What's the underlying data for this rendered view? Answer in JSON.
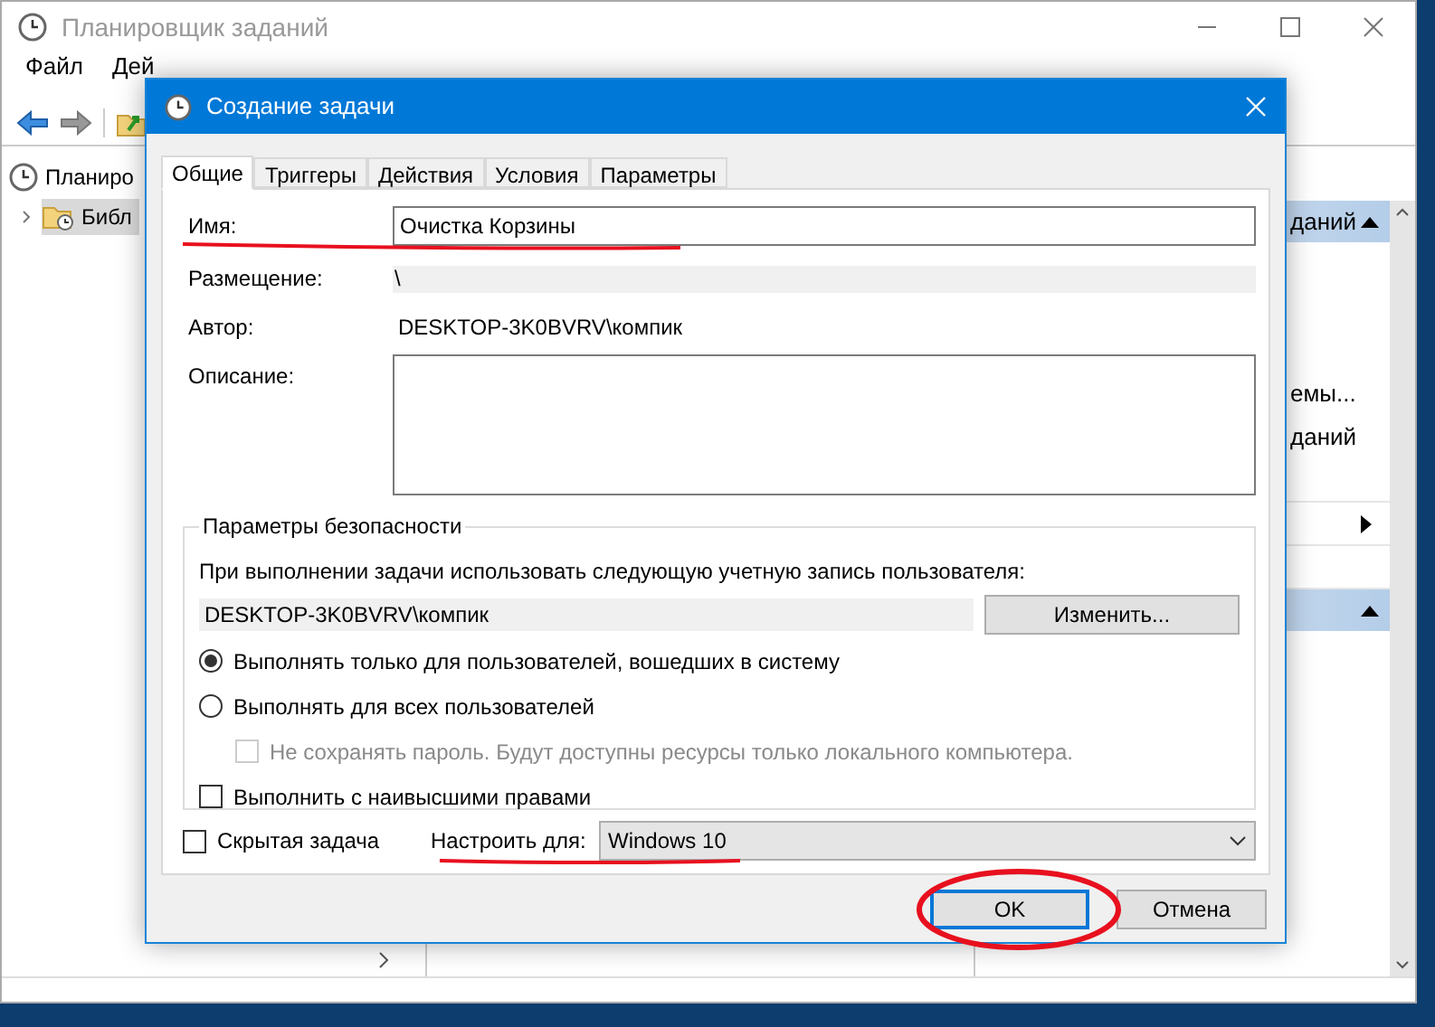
{
  "main_window": {
    "title": "Планировщик заданий",
    "menu": [
      "Файл",
      "Дей"
    ],
    "tree": [
      {
        "label": "Планиро",
        "selected": false,
        "children": [
          {
            "label": "Библ",
            "selected": true,
            "expanded": false
          }
        ]
      }
    ],
    "actions_pane": {
      "sections": [
        {
          "header": "даний",
          "expanded": true,
          "items": [
            {
              "label": "емы..."
            },
            {
              "label": "даний"
            },
            {
              "submenu": false
            },
            {
              "submenu": true
            },
            {
              "submenu": false
            }
          ]
        },
        {
          "expanded": true
        }
      ]
    }
  },
  "dialog": {
    "title": "Создание задачи",
    "tabs": [
      {
        "label": "Общие",
        "selected": true
      },
      {
        "label": "Триггеры",
        "selected": false
      },
      {
        "label": "Действия",
        "selected": false
      },
      {
        "label": "Условия",
        "selected": false
      },
      {
        "label": "Параметры",
        "selected": false
      }
    ],
    "name": {
      "label": "Имя:",
      "value": "Очистка Корзины"
    },
    "location": {
      "label": "Размещение:",
      "value": "\\"
    },
    "author": {
      "label": "Автор:",
      "value": "DESKTOP-3K0BVRV\\компик"
    },
    "description": {
      "label": "Описание:"
    },
    "security": {
      "title": "Параметры безопасности",
      "account_prompt": "При выполнении задачи использовать следующую учетную запись пользователя:",
      "account": "DESKTOP-3K0BVRV\\компик",
      "change_button": "Изменить...",
      "options": [
        {
          "kind": "radio",
          "label": "Выполнять только для пользователей, вошедших в систему",
          "selected": true
        },
        {
          "kind": "radio",
          "label": "Выполнять для всех пользователей",
          "selected": false,
          "children": [
            {
              "kind": "checkbox",
              "label": "Не сохранять пароль. Будут доступны ресурсы только локального компьютера.",
              "checked": false,
              "disabled": true
            }
          ]
        },
        {
          "kind": "checkbox",
          "label": "Выполнить с наивысшими правами",
          "checked": false,
          "disabled": false
        }
      ]
    },
    "hidden_task": {
      "label": "Скрытая задача",
      "checked": false
    },
    "configure_for": {
      "label": "Настроить для:",
      "value": "Windows 10"
    },
    "buttons": [
      {
        "label": "OK",
        "default": true
      },
      {
        "label": "Отмена",
        "default": false
      }
    ]
  }
}
